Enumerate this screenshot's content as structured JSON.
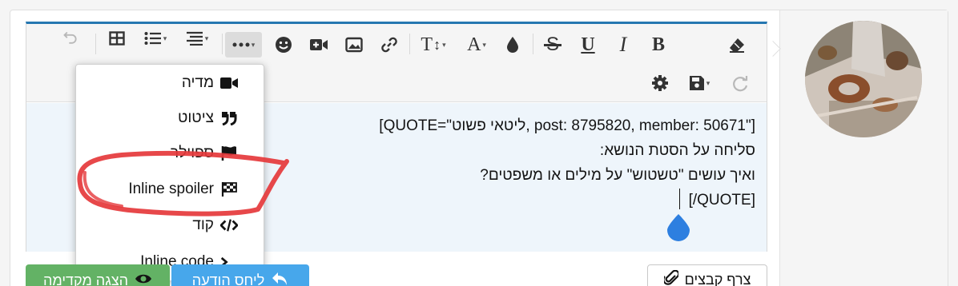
{
  "editor": {
    "toolbar_icons": [
      "undo-icon",
      "table-icon",
      "list-icon",
      "align-icon",
      "more-icon",
      "emoji-icon",
      "video-icon",
      "image-icon",
      "link-icon",
      "font-size-icon",
      "text-color-icon",
      "drop-icon",
      "strikethrough-icon",
      "underline-icon",
      "italic-icon",
      "bold-icon",
      "eraser-icon",
      "settings-icon",
      "save-icon",
      "redo-icon"
    ],
    "bold_label": "B",
    "italic_label": "I",
    "underline_label": "U",
    "strike_label": "S",
    "font_size_label": "T",
    "text_color_label": "A",
    "content_lines": [
      "[QUOTE=\"ליטאי פשוט, post: 8795820, member: 50671\"]",
      "סליחה על הסטת הנושא:",
      "ואיך עושים \"טשטוש\" על מילים או משפטים?",
      "[/QUOTE]"
    ]
  },
  "dropdown": {
    "items": [
      {
        "label": "מדיה",
        "icon": "video-icon"
      },
      {
        "label": "ציטוט",
        "icon": "quote-icon"
      },
      {
        "label": "ספוילר",
        "icon": "flag-icon"
      },
      {
        "label": "Inline spoiler",
        "icon": "checkered-flag-icon"
      },
      {
        "label": "קוד",
        "icon": "code-icon"
      },
      {
        "label": "Inline code",
        "icon": "terminal-icon"
      }
    ]
  },
  "actions": {
    "attach_label": "צרף קבצים",
    "reply_label": "ליחס הודעה",
    "preview_label": "הצגה מקדימה"
  },
  "colors": {
    "accent": "#2577b1",
    "reply_button": "#47a7eb",
    "preview_button": "#63b265",
    "annotation": "#e5383b",
    "cursor_drop": "#2d7fe0"
  }
}
